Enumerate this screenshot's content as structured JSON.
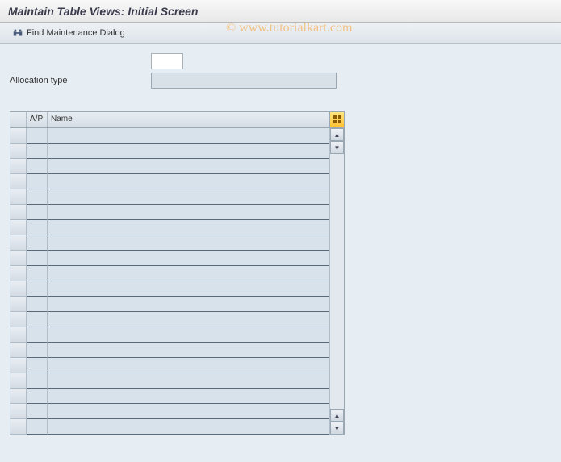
{
  "header": {
    "title": "Maintain Table Views: Initial Screen"
  },
  "toolbar": {
    "find_dialog_label": "Find Maintenance Dialog"
  },
  "form": {
    "allocation_type_label": "Allocation type",
    "small_field_value": "",
    "long_field_value": ""
  },
  "table": {
    "columns": {
      "selector": "",
      "ap": "A/P",
      "name": "Name"
    },
    "row_count": 20,
    "rows": [
      {
        "ap": "",
        "name": ""
      },
      {
        "ap": "",
        "name": ""
      },
      {
        "ap": "",
        "name": ""
      },
      {
        "ap": "",
        "name": ""
      },
      {
        "ap": "",
        "name": ""
      },
      {
        "ap": "",
        "name": ""
      },
      {
        "ap": "",
        "name": ""
      },
      {
        "ap": "",
        "name": ""
      },
      {
        "ap": "",
        "name": ""
      },
      {
        "ap": "",
        "name": ""
      },
      {
        "ap": "",
        "name": ""
      },
      {
        "ap": "",
        "name": ""
      },
      {
        "ap": "",
        "name": ""
      },
      {
        "ap": "",
        "name": ""
      },
      {
        "ap": "",
        "name": ""
      },
      {
        "ap": "",
        "name": ""
      },
      {
        "ap": "",
        "name": ""
      },
      {
        "ap": "",
        "name": ""
      },
      {
        "ap": "",
        "name": ""
      },
      {
        "ap": "",
        "name": ""
      }
    ]
  },
  "watermark": {
    "text": "© www.tutorialkart.com"
  },
  "icons": {
    "binoculars": "binoculars-icon",
    "table_settings": "table-settings-icon",
    "scroll_up": "▲",
    "scroll_down": "▼"
  },
  "colors": {
    "app_background": "#e6edf3",
    "field_background": "#d8e0e8",
    "header_gradient_top": "#f8f8f8",
    "header_gradient_bottom": "#e8e8e8",
    "watermark_color": "rgba(250,140,0,0.45)"
  }
}
